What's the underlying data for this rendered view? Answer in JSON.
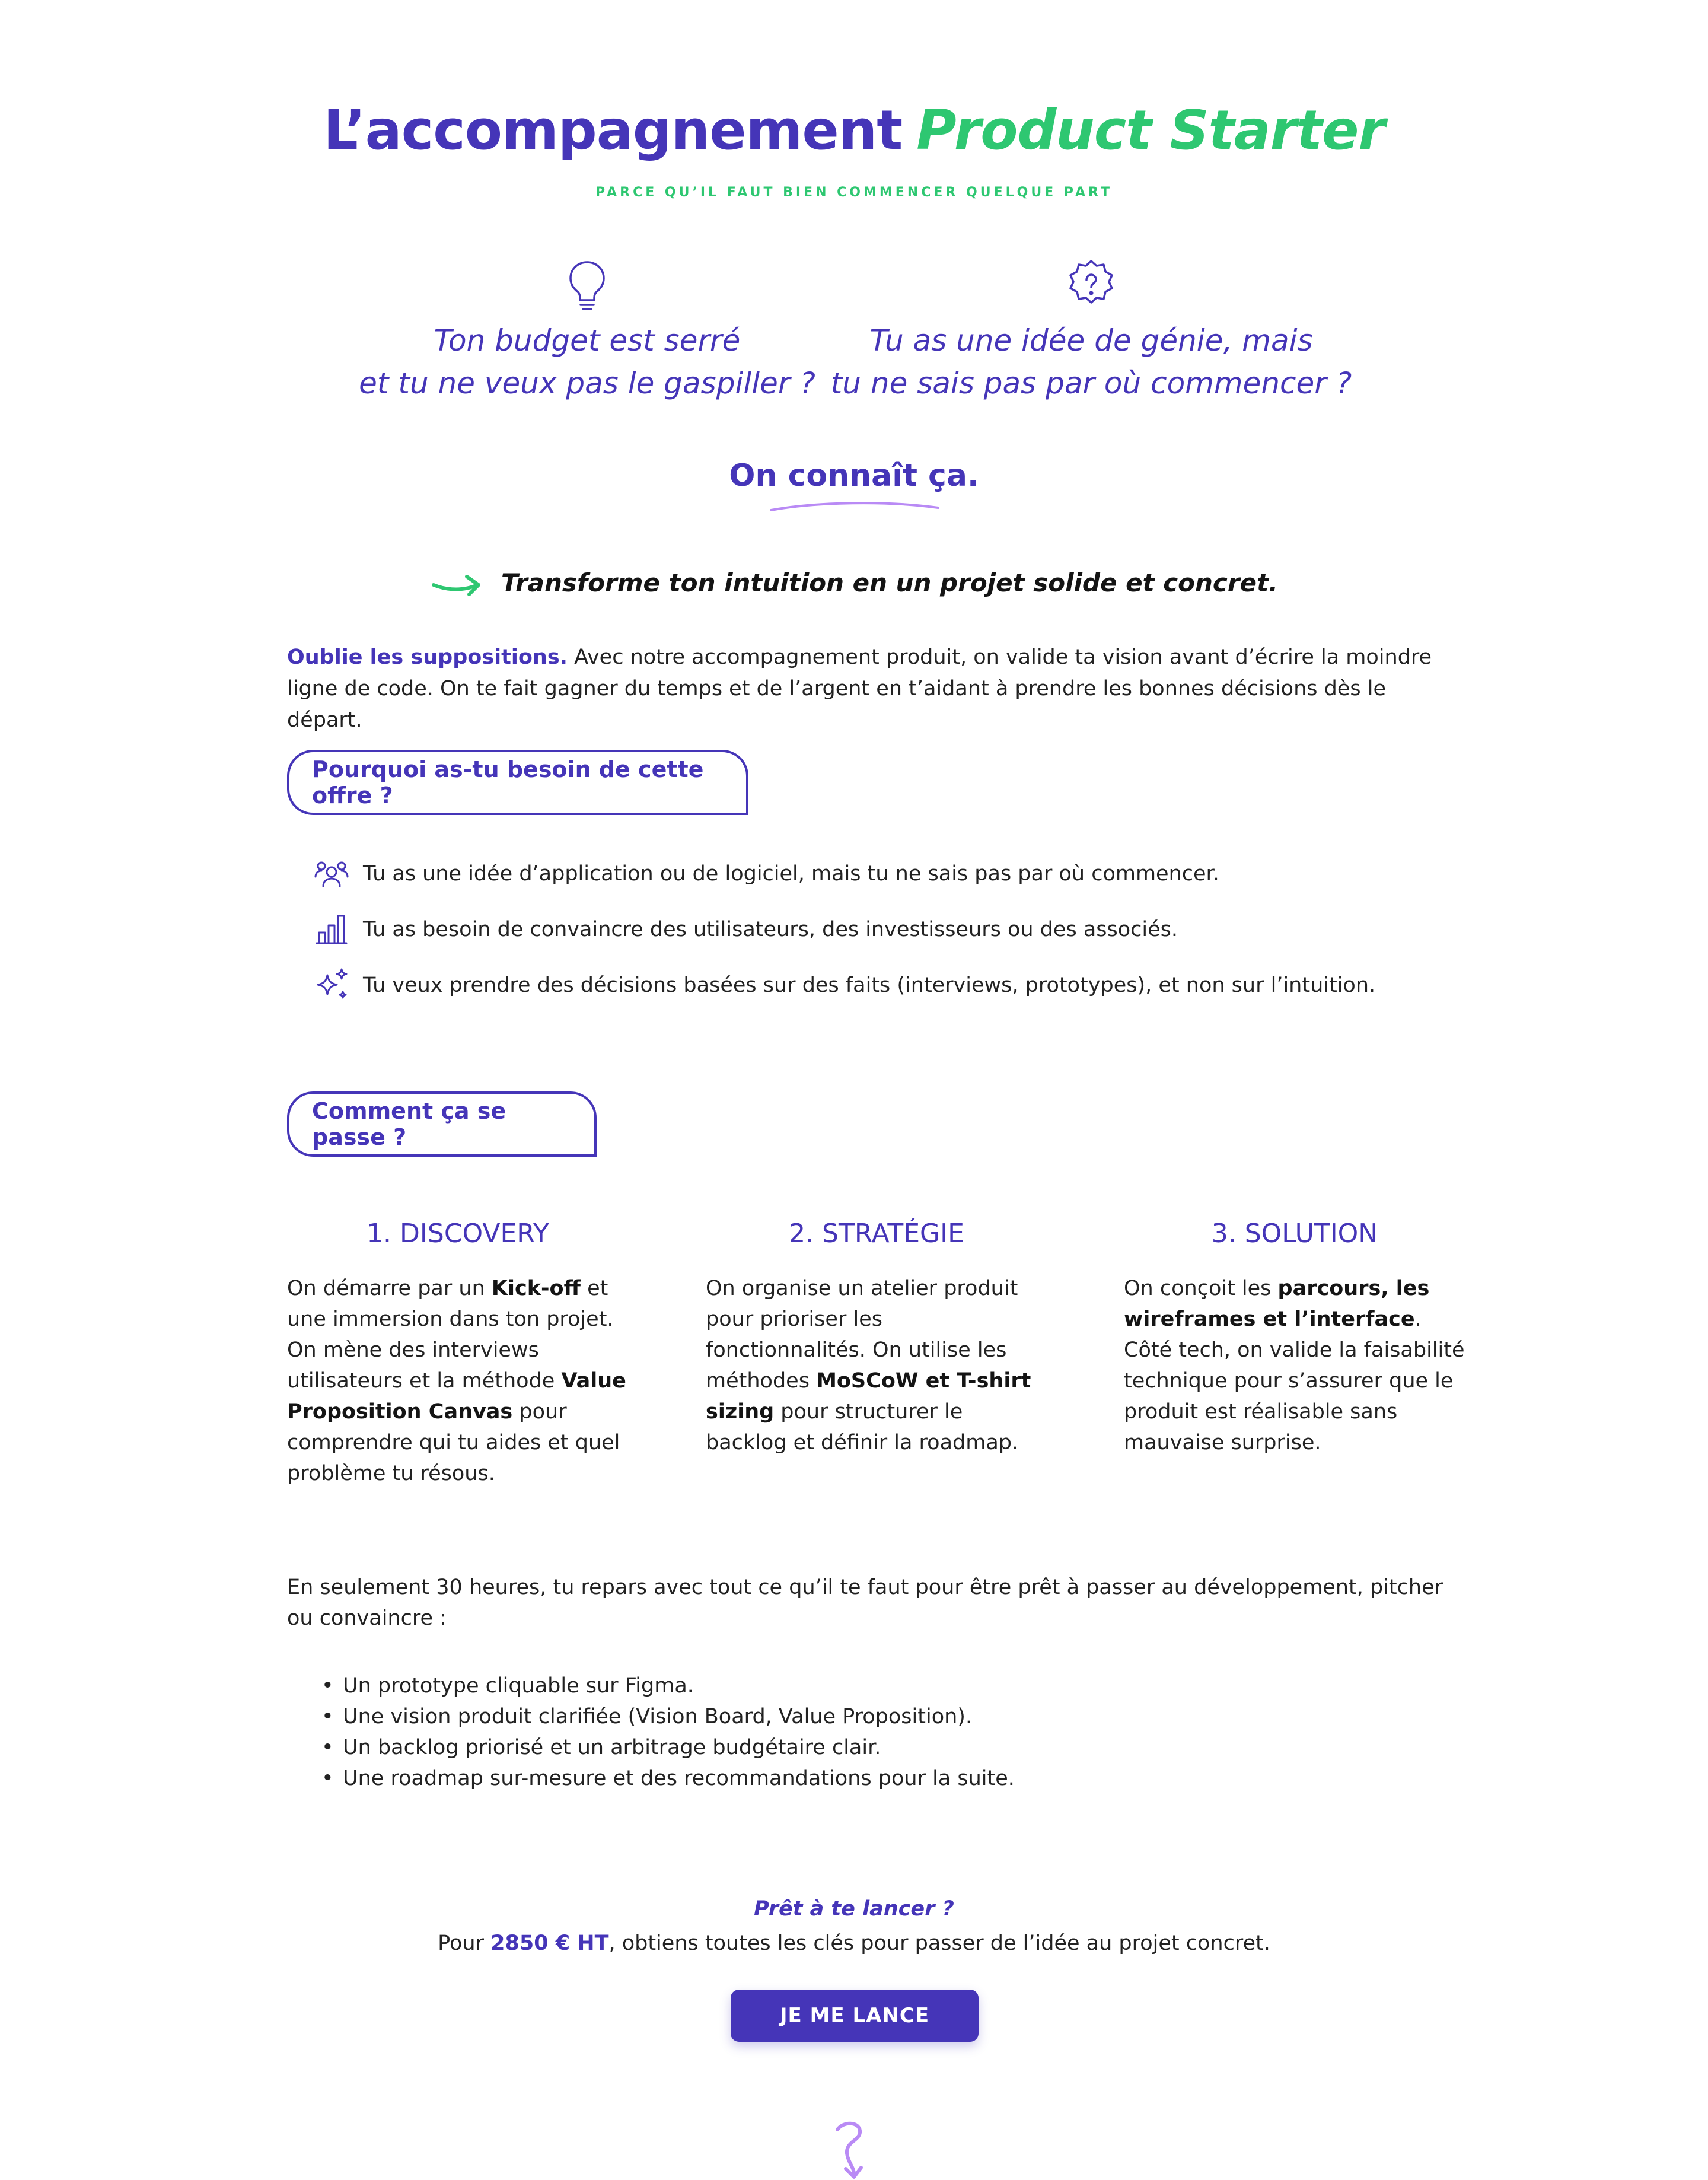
{
  "header": {
    "title_main": "L’accompagnement",
    "title_accent": "Product Starter",
    "subtitle": "PARCE QU’IL FAUT BIEN COMMENCER QUELQUE PART"
  },
  "pain_points": [
    {
      "icon": "lightbulb-icon",
      "line1": "Ton budget est serré",
      "line2": "et tu ne veux pas le gaspiller ?"
    },
    {
      "icon": "question-badge-icon",
      "line1": "Tu as une idée de génie, mais",
      "line2": "tu ne sais pas par où commencer ?"
    }
  ],
  "known": "On connaît ça.",
  "tagline": "Transforme ton intuition en un projet solide et concret.",
  "intro": {
    "lead": "Oublie les suppositions.",
    "body": " Avec notre accompagnement produit, on valide ta vision avant d’écrire la moindre ligne de code. On te fait gagner du temps et de l’argent en t’aidant à prendre les bonnes décisions dès le départ."
  },
  "why": {
    "label": "Pourquoi as-tu besoin de cette offre ?",
    "items": [
      {
        "icon": "users-icon",
        "text": "Tu as une idée d’application ou de logiciel, mais tu ne sais pas par où commencer."
      },
      {
        "icon": "bar-chart-icon",
        "text": "Tu as besoin de convaincre des utilisateurs, des investisseurs ou des associés."
      },
      {
        "icon": "sparkles-icon",
        "text": "Tu veux prendre des décisions basées sur des faits (interviews, prototypes), et non sur l’intuition."
      }
    ]
  },
  "how": {
    "label": "Comment ça se passe ?",
    "steps": [
      {
        "title": "1. DISCOVERY",
        "t1": "On démarre par un ",
        "b1": "Kick-off",
        "t2": " et une immersion dans ton projet. On mène des interviews utilisateurs et la méthode ",
        "b2": "Value Proposition Canvas",
        "t3": " pour comprendre qui tu aides et quel problème tu résous."
      },
      {
        "title": "2. STRATÉGIE",
        "t1": "On organise un atelier produit pour prioriser les fonctionnalités. On utilise les méthodes ",
        "b1": "MoSCoW et T-shirt sizing",
        "t2": " pour structurer le backlog et définir la roadmap.",
        "b2": "",
        "t3": ""
      },
      {
        "title": "3. SOLUTION",
        "t1": "On conçoit les ",
        "b1": "parcours, les wireframes et l’interface",
        "t2": ". Côté tech, on valide la faisabilité technique pour s’assurer que le produit est réalisable sans mauvaise surprise.",
        "b2": "",
        "t3": ""
      }
    ]
  },
  "summary": "En seulement 30 heures, tu repars avec tout ce qu’il te faut pour être prêt à passer au développement, pitcher ou convaincre :",
  "deliverables": [
    "Un prototype cliquable sur Figma.",
    "Une vision produit clarifiée (Vision Board, Value Proposition).",
    "Un backlog priorisé et un arbitrage budgétaire clair.",
    "Une roadmap sur-mesure et des recommandations pour la suite."
  ],
  "cta": {
    "title": "Prêt à te lancer ?",
    "price_prefix": "Pour ",
    "price": "2850 € HT",
    "price_suffix": ", obtiens toutes les clés pour passer de l’idée au projet concret.",
    "button": "JE ME LANCE"
  },
  "colors": {
    "primary": "#4535b8",
    "accent": "#2ec771",
    "highlight": "#b98af5",
    "text": "#222222"
  }
}
